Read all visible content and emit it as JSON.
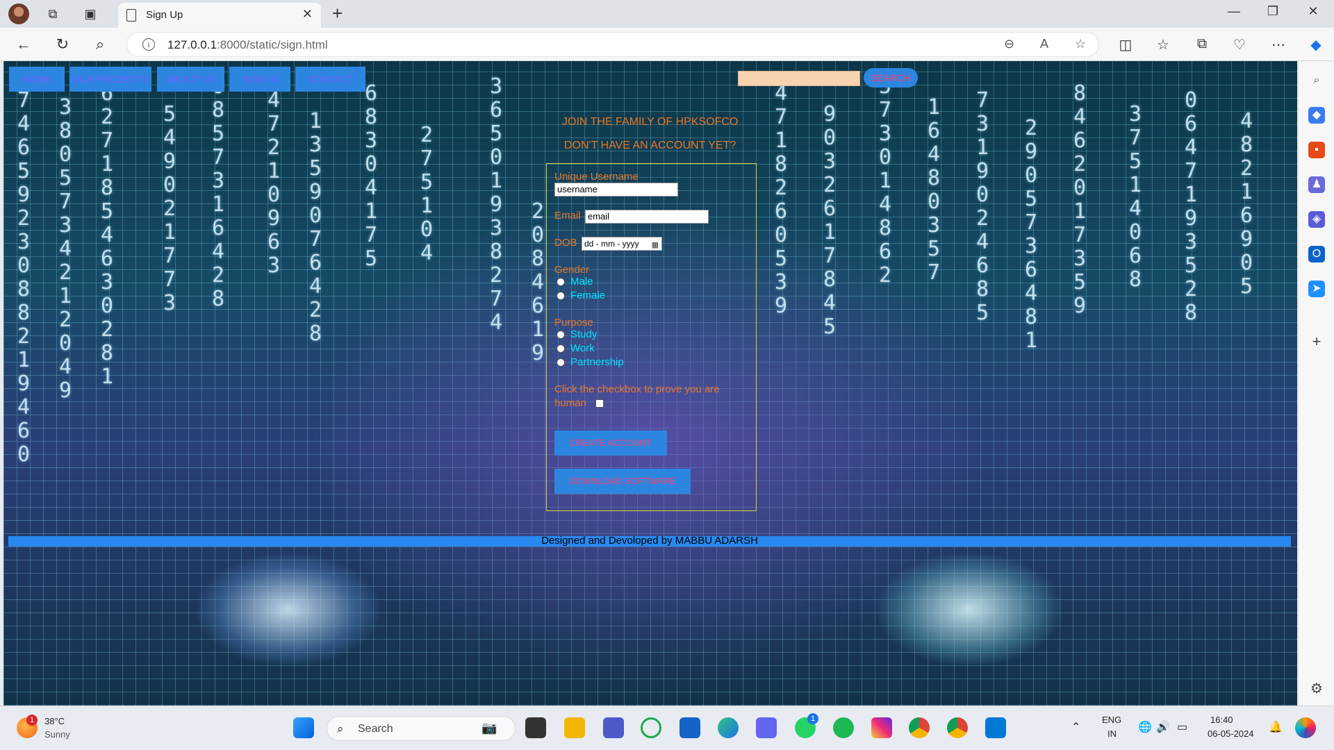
{
  "browser": {
    "tab_title": "Sign Up",
    "url_host": "127.0.0.1",
    "url_path": ":8000/static/sign.html"
  },
  "page": {
    "nav": [
      "HOME",
      "OUR PROJECTS",
      "ABOUT US",
      "SIGN IN",
      "CONTACT"
    ],
    "search_button": "SEARCH",
    "heading1": "JOIN THE FAMILY OF HPKSOFCO",
    "heading2": "DON'T HAVE AN ACCOUNT YET?",
    "form": {
      "username_label": "Unique Username",
      "username_value": "username",
      "email_label": "Email",
      "email_value": "email",
      "dob_label": "DOB",
      "dob_placeholder": "dd - mm - yyyy",
      "gender_label": "Gender",
      "gender_options": [
        "Male",
        "Female"
      ],
      "purpose_label": "Purpose",
      "purpose_options": [
        "Study",
        "Work",
        "Partnership"
      ],
      "human_label_1": "Click the checkbox to prove you are",
      "human_label_2": "human",
      "create_button": "CREATE ACCOUNT",
      "download_button": "DOWNLOAD SOFTWARE"
    },
    "footer": "Designed and Devoloped by MABBU ADARSH"
  },
  "taskbar": {
    "temperature": "38°C",
    "weather": "Sunny",
    "weather_badge": "1",
    "search_placeholder": "Search",
    "lang_1": "ENG",
    "lang_2": "IN",
    "time": "16:40",
    "date": "06-05-2024",
    "whatsapp_badge": "1"
  },
  "colors": {
    "nav_bg": "#2c86e0",
    "nav_text": "#7a5cff",
    "label_orange": "#e8772a",
    "option_cyan": "#00e5ff",
    "button_text": "#ff3d6e",
    "footer_bar": "#2789ef"
  }
}
